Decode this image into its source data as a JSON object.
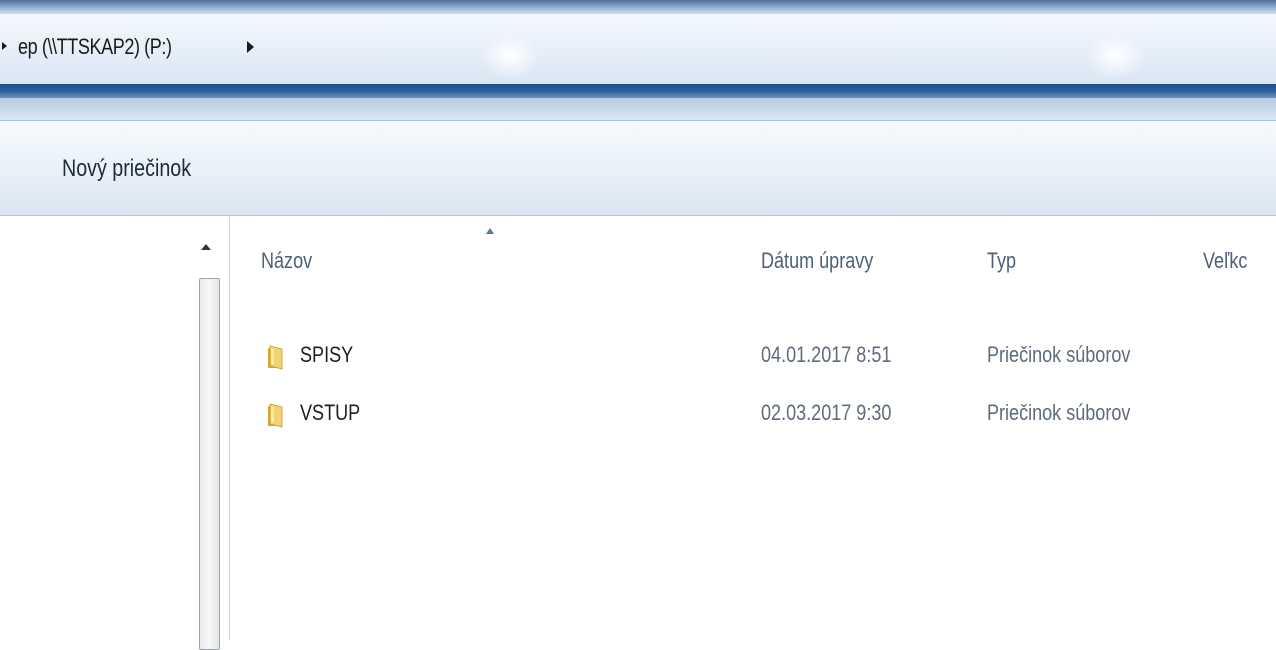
{
  "address_bar": {
    "breadcrumb": "ep (\\\\TTSKAP2) (P:)"
  },
  "toolbar": {
    "new_folder_label": "Nový priečinok"
  },
  "file_list": {
    "columns": {
      "name": "Názov",
      "date": "Dátum úpravy",
      "type": "Typ",
      "size": "Veľkc"
    },
    "rows": [
      {
        "name": "SPISY",
        "date": "04.01.2017 8:51",
        "type": "Priečinok súborov",
        "icon": "folder-icon"
      },
      {
        "name": "VSTUP",
        "date": "02.03.2017 9:30",
        "type": "Priečinok súborov",
        "icon": "folder-icon"
      }
    ]
  }
}
